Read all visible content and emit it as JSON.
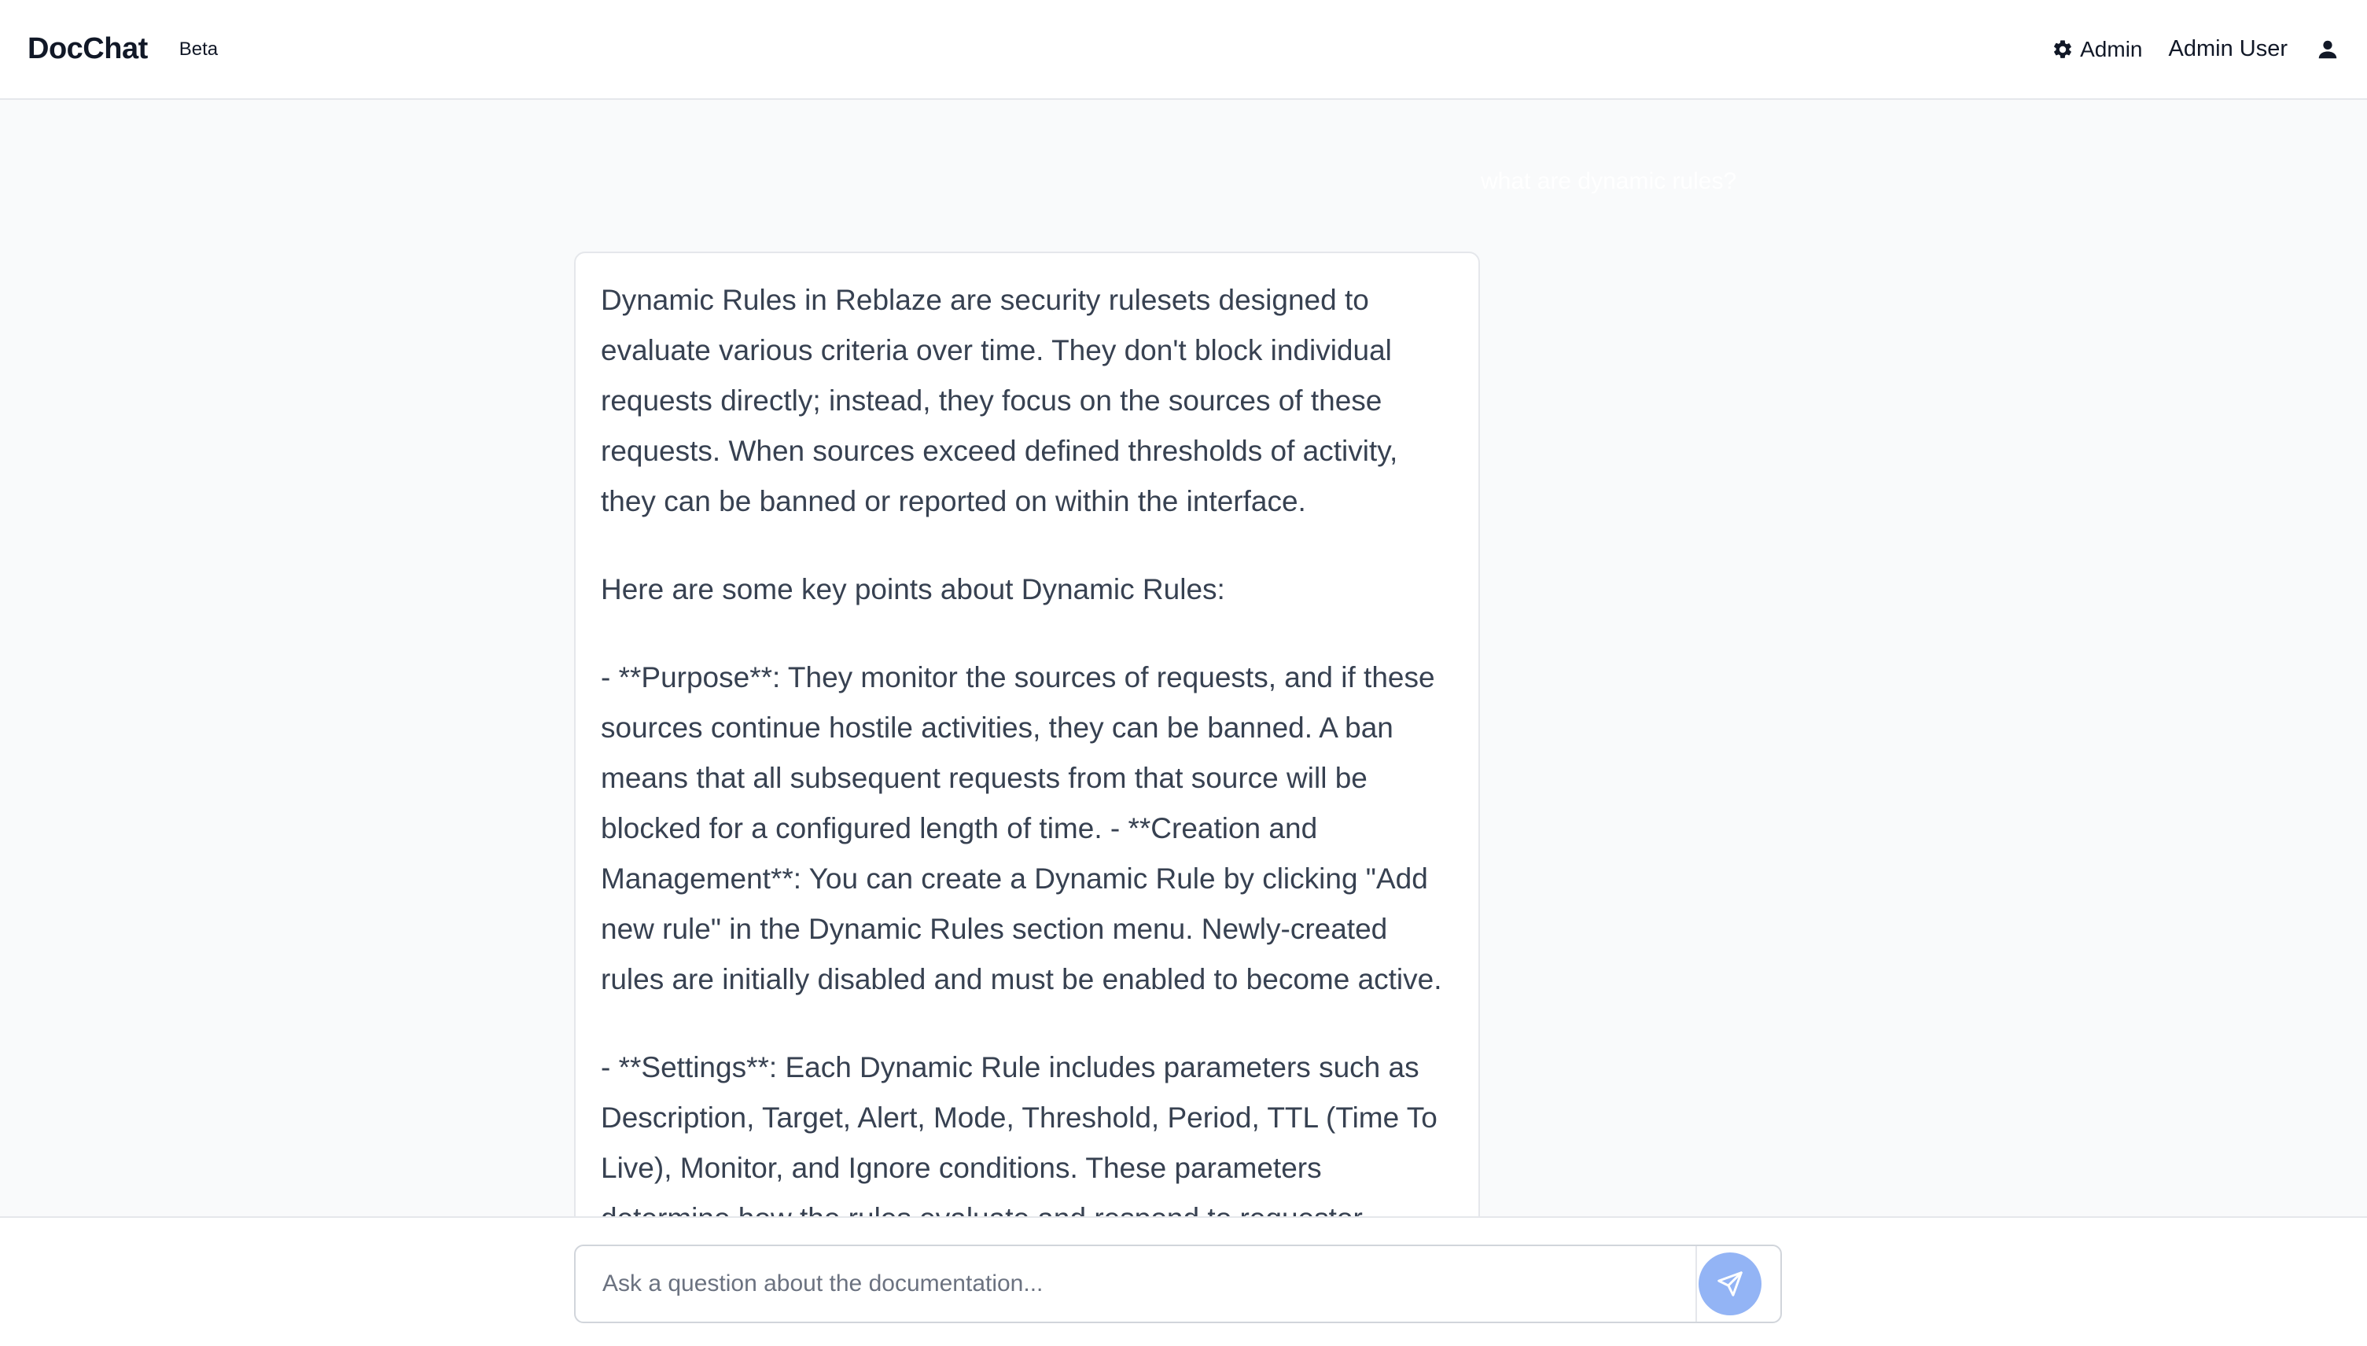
{
  "header": {
    "brand": "DocChat",
    "badge": "Beta",
    "admin_link": "Admin",
    "user_name": "Admin User"
  },
  "chat": {
    "user_message": "what are dynamic rules?",
    "answer_paragraphs": [
      "Dynamic Rules in Reblaze are security rulesets designed to evaluate various criteria over time. They don't block individual requests directly; instead, they focus on the sources of these requests. When sources exceed defined thresholds of activity, they can be banned or reported on within the interface.",
      "Here are some key points about Dynamic Rules:",
      "- **Purpose**: They monitor the sources of requests, and if these sources continue hostile activities, they can be banned. A ban means that all subsequent requests from that source will be blocked for a configured length of time. - **Creation and Management**: You can create a Dynamic Rule by clicking \"Add new rule\" in the Dynamic Rules section menu. Newly-created rules are initially disabled and must be enabled to become active.",
      "- **Settings**: Each Dynamic Rule includes parameters such as Description, Target, Alert, Mode, Threshold, Period, TTL (Time To Live), Monitor, and Ignore conditions. These parameters determine how the rules evaluate and respond to requestor activities."
    ]
  },
  "composer": {
    "placeholder": "Ask a question about the documentation...",
    "value": ""
  },
  "icons": {
    "admin": "gear-icon",
    "user": "user-icon",
    "send": "send-icon"
  },
  "colors": {
    "send_button": "#93b4f5",
    "background": "#f9fafb"
  }
}
